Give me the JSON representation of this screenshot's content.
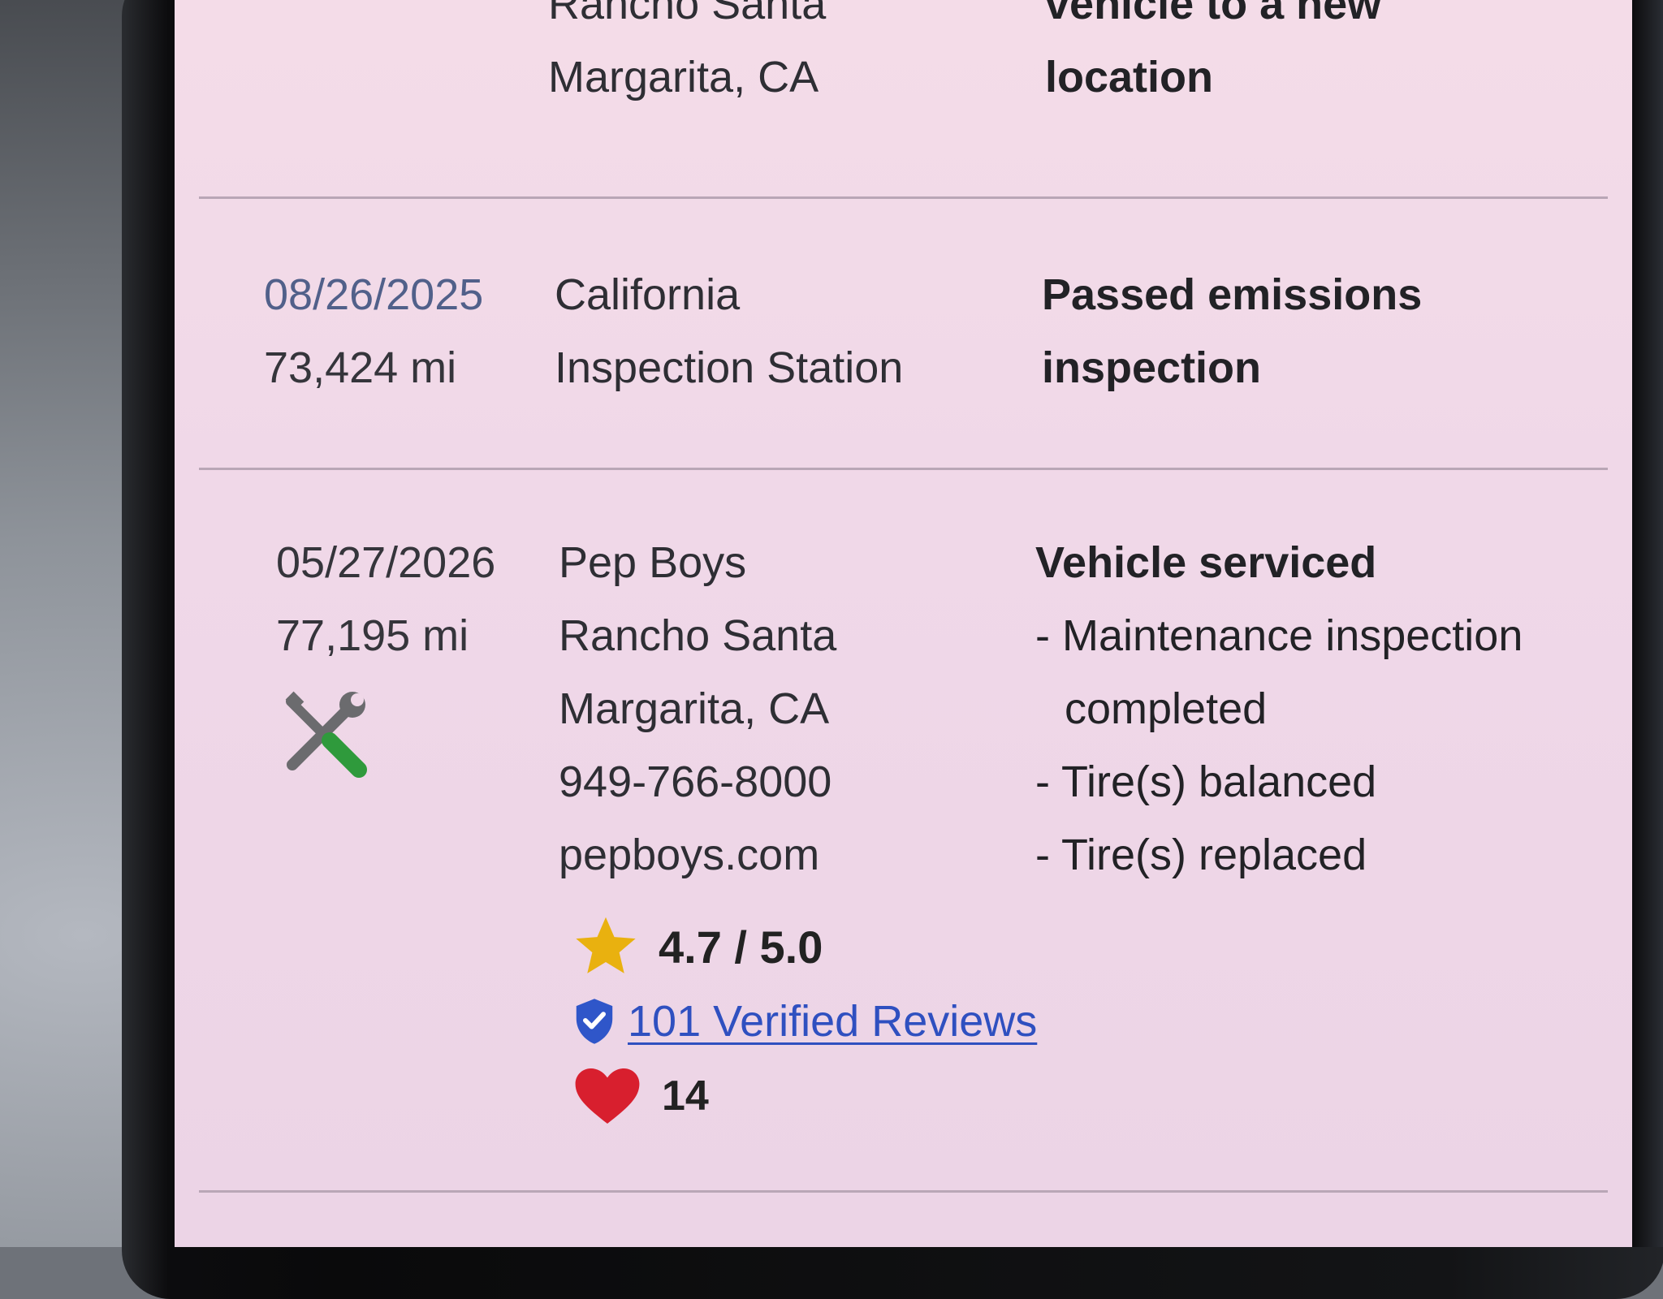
{
  "history": {
    "records": [
      {
        "date": "",
        "mileage": "",
        "source_lines": [
          "Rancho Santa",
          "Margarita, CA"
        ],
        "description_title_lines": [
          "vehicle to a new",
          "location"
        ]
      },
      {
        "date": "08/26/2025",
        "mileage": "73,424 mi",
        "source_lines": [
          "California",
          "Inspection Station"
        ],
        "description_title_lines": [
          "Passed emissions",
          "inspection"
        ]
      },
      {
        "date": "05/27/2026",
        "mileage": "77,195 mi",
        "icon": "tools-icon",
        "source_lines": [
          "Pep Boys",
          "Rancho Santa",
          "Margarita, CA",
          "949-766-8000",
          "pepboys.com"
        ],
        "description_title": "Vehicle serviced",
        "description_items": [
          "- Maintenance inspection completed",
          "- Tire(s) balanced",
          "- Tire(s) replaced"
        ],
        "rating": "4.7 / 5.0",
        "reviews_link": "101 Verified Reviews",
        "favorites": "14"
      }
    ]
  },
  "colors": {
    "screen_background": "#f0d8e8",
    "date_text": "#51608a",
    "link": "#2f50c0",
    "star": "#e9b10f",
    "heart": "#d81f2e",
    "shield": "#2f56c9",
    "icon_green": "#2f9a3c"
  },
  "icons": {
    "service": "tools-icon",
    "rating": "star-icon",
    "verified": "shield-check-icon",
    "favorite": "heart-icon"
  }
}
